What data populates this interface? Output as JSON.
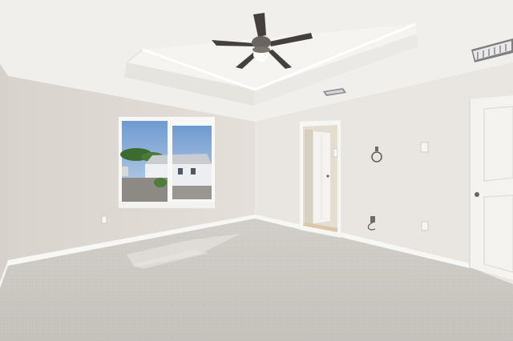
{
  "scene": {
    "description_free": true
  },
  "colors": {
    "ceiling": "#f1f0ed",
    "tray_ceiling": "#ecebe7",
    "left_wall": "#e3ded7",
    "back_wall": "#e6e2dc",
    "right_wall": "#eae7e2",
    "carpet": "#cfccc6",
    "trim": "#f7f7f5",
    "fan_blade": "#45403d",
    "sky": "#8fb2d8"
  },
  "icons": {
    "fan": "ceiling-fan-icon",
    "vent": "air-vent-icon",
    "outlet": "outlet-icon",
    "switch": "light-switch-icon",
    "hook": "towel-ring-icon"
  }
}
